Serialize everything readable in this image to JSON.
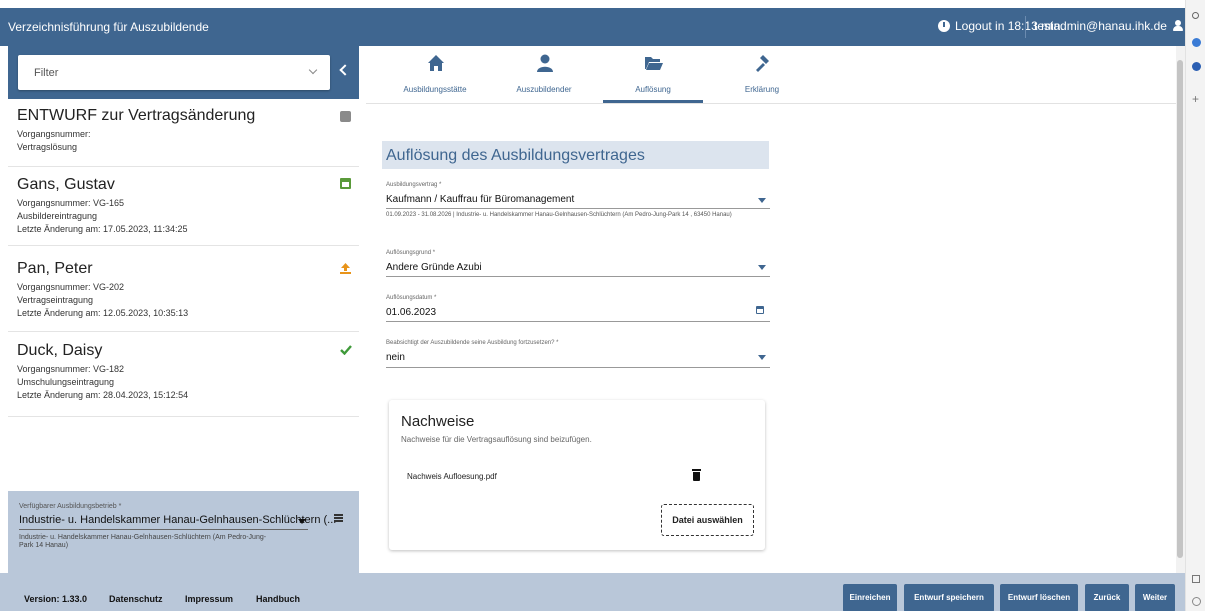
{
  "header": {
    "app_title": "Verzeichnisführung für Auszubildende",
    "logout_text": "Logout in 18:13 min.",
    "user_email": "testadmin@hanau.ihk.de"
  },
  "sidebar": {
    "filter_label": "Filter",
    "items": [
      {
        "title": "ENTWURF zur Vertragsänderung",
        "lines": [
          "Vorgangsnummer:",
          "Vertragslösung"
        ],
        "icon": "edit-icon",
        "icon_color": "#777777"
      },
      {
        "title": "Gans, Gustav",
        "lines": [
          "Vorgangsnummer: VG-165",
          "Ausbildereintragung",
          "Letzte Änderung am: 17.05.2023, 11:34:25"
        ],
        "icon": "calendar-icon",
        "icon_color": "#5a9a3a"
      },
      {
        "title": "Pan, Peter",
        "lines": [
          "Vorgangsnummer: VG-202",
          "Vertragseintragung",
          "Letzte Änderung am: 12.05.2023, 10:35:13"
        ],
        "icon": "upload-icon",
        "icon_color": "#e8941a"
      },
      {
        "title": "Duck, Daisy",
        "lines": [
          "Vorgangsnummer: VG-182",
          "Umschulungseintragung",
          "Letzte Änderung am: 28.04.2023, 15:12:54"
        ],
        "icon": "check-icon",
        "icon_color": "#3f9a3a"
      }
    ],
    "betrieb_label": "Verfügbarer Ausbildungsbetrieb *",
    "betrieb_value": "Industrie- u. Handelskammer Hanau-Gelnhausen-Schlüchtern (...",
    "betrieb_hint": "Industrie- u. Handelskammer Hanau-Gelnhausen-Schlüchtern (Am Pedro-Jung-Park 14 Hanau)"
  },
  "tabs": [
    {
      "label": "Ausbildungsstätte",
      "icon": "home-icon"
    },
    {
      "label": "Auszubildender",
      "icon": "person-icon"
    },
    {
      "label": "Auflösung",
      "icon": "folder-open-icon",
      "active": true
    },
    {
      "label": "Erklärung",
      "icon": "gavel-icon"
    }
  ],
  "form": {
    "section_title": "Auflösung des Ausbildungsvertrages",
    "vertrag_label": "Ausbildungsvertrag *",
    "vertrag_value": "Kaufmann / Kauffrau für Büromanagement",
    "vertrag_hint": "01.09.2023 - 31.08.2026 | Industrie- u. Handelskammer Hanau-Gelnhausen-Schlüchtern (Am Pedro-Jung-Park 14 , 63450 Hanau)",
    "grund_label": "Auflösungsgrund *",
    "grund_value": "Andere Gründe Azubi",
    "datum_label": "Auflösungsdatum *",
    "datum_value": "01.06.2023",
    "fortsetzen_label": "Beabsichtigt der Auszubildende seine Ausbildung fortzusetzen? *",
    "fortsetzen_value": "nein"
  },
  "nachweise": {
    "title": "Nachweise",
    "subtitle": "Nachweise für die Vertragsauflösung sind beizufügen.",
    "file_name": "Nachweis Aufloesung.pdf",
    "select_button": "Datei auswählen"
  },
  "footer": {
    "version": "Version: 1.33.0",
    "links": [
      "Datenschutz",
      "Impressum",
      "Handbuch"
    ],
    "buttons": [
      "Einreichen",
      "Entwurf speichern",
      "Entwurf löschen",
      "Zurück",
      "Weiter"
    ]
  },
  "colors": {
    "brand": "#3f6690",
    "footer_bg": "#b9c7d9",
    "section_bg": "#dce4ee"
  }
}
